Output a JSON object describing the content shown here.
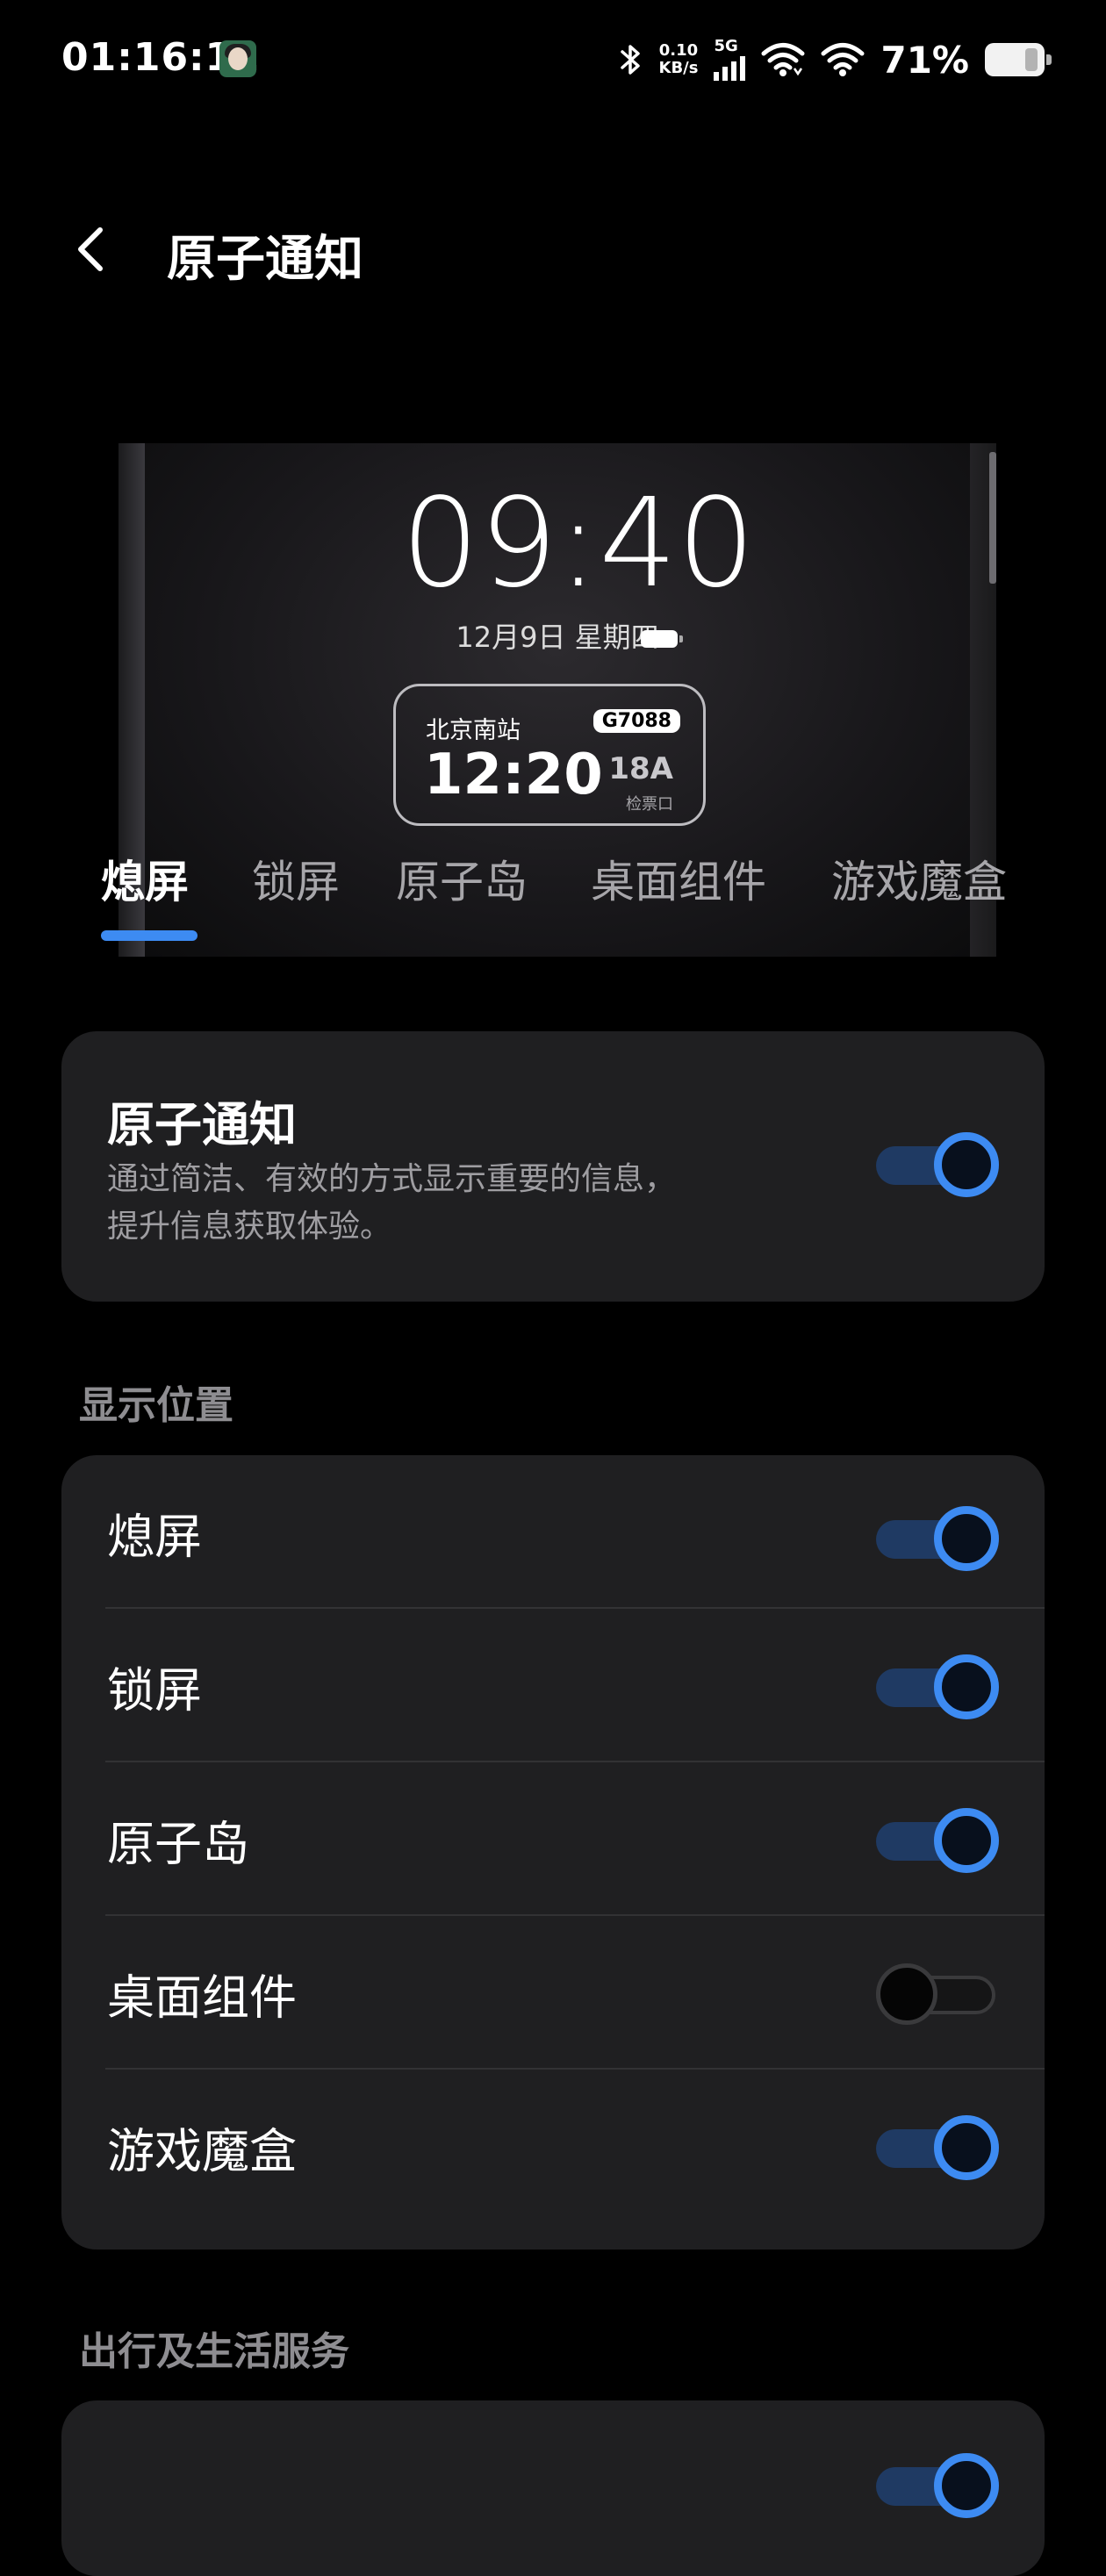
{
  "status_bar": {
    "time": "01:16:12",
    "speed_value": "0.10",
    "speed_unit": "KB/s",
    "network": "5G",
    "battery": "71%"
  },
  "header": {
    "title": "原子通知"
  },
  "preview": {
    "clock": "09:40",
    "date": "12月9日 星期四",
    "ticket": {
      "station": "北京南站",
      "train": "G7088",
      "time": "12:20",
      "seat": "18A",
      "gate": "检票口"
    }
  },
  "tabs": [
    {
      "label": "熄屏",
      "active": true
    },
    {
      "label": "锁屏",
      "active": false
    },
    {
      "label": "原子岛",
      "active": false
    },
    {
      "label": "桌面组件",
      "active": false
    },
    {
      "label": "游戏魔盒",
      "active": false
    }
  ],
  "main_setting": {
    "title": "原子通知",
    "description_line1": "通过简洁、有效的方式显示重要的信息，",
    "description_line2": "提升信息获取体验。",
    "enabled": true
  },
  "display_position": {
    "section_label": "显示位置",
    "rows": [
      {
        "label": "熄屏",
        "enabled": true
      },
      {
        "label": "锁屏",
        "enabled": true
      },
      {
        "label": "原子岛",
        "enabled": true
      },
      {
        "label": "桌面组件",
        "enabled": false
      },
      {
        "label": "游戏魔盒",
        "enabled": true
      }
    ]
  },
  "services": {
    "section_label": "出行及生活服务"
  },
  "colors": {
    "accent": "#3d8bf2",
    "card": "#1f1f21",
    "background": "#000000"
  }
}
